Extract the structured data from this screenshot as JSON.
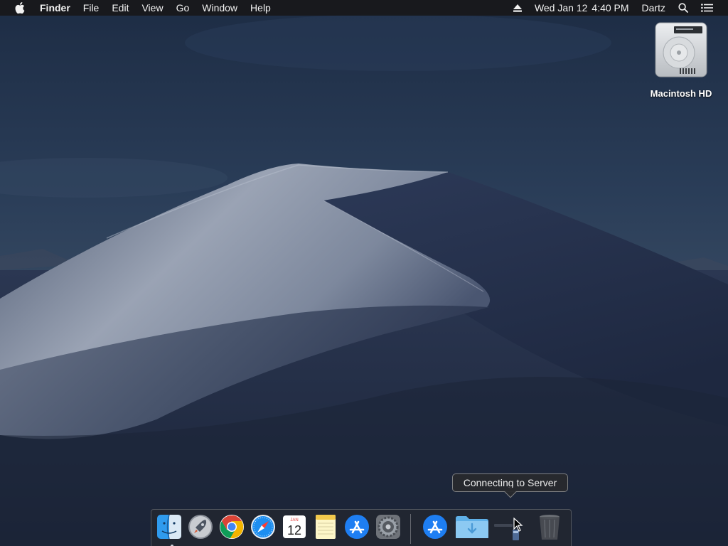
{
  "menubar": {
    "apple_icon": "apple-logo-icon",
    "app_name": "Finder",
    "menus": [
      "File",
      "Edit",
      "View",
      "Go",
      "Window",
      "Help"
    ],
    "eject_icon": "eject-icon",
    "date": "Wed Jan 12",
    "time": "4:40 PM",
    "user": "Dartz",
    "spotlight_icon": "search-icon",
    "notifications_icon": "list-icon"
  },
  "desktop": {
    "icons": [
      {
        "label": "Macintosh HD",
        "icon": "hard-drive-icon"
      }
    ]
  },
  "tooltip": {
    "text": "Connecting to Server"
  },
  "dock": {
    "apps": [
      {
        "name": "finder",
        "icon": "finder-icon",
        "running": true
      },
      {
        "name": "launchpad",
        "icon": "rocket-icon",
        "running": false
      },
      {
        "name": "chrome",
        "icon": "chrome-icon",
        "running": false
      },
      {
        "name": "safari",
        "icon": "compass-icon",
        "running": false
      },
      {
        "name": "calendar",
        "icon": "calendar-icon",
        "running": false,
        "month": "JAN",
        "day": "12"
      },
      {
        "name": "notes",
        "icon": "notes-icon",
        "running": false
      },
      {
        "name": "app-store",
        "icon": "app-store-icon",
        "running": false
      },
      {
        "name": "system-preferences",
        "icon": "gear-icon",
        "running": false
      }
    ],
    "others": [
      {
        "name": "app-store-download",
        "icon": "app-store-icon"
      },
      {
        "name": "downloads-folder",
        "icon": "folder-icon"
      },
      {
        "name": "server-document",
        "icon": "document-icon"
      },
      {
        "name": "trash",
        "icon": "trash-icon"
      }
    ]
  },
  "colors": {
    "menubar_bg": "#18181a",
    "sky_top": "#1f3049",
    "dune_light": "#8f98ab",
    "dune_shadow": "#25304a"
  }
}
